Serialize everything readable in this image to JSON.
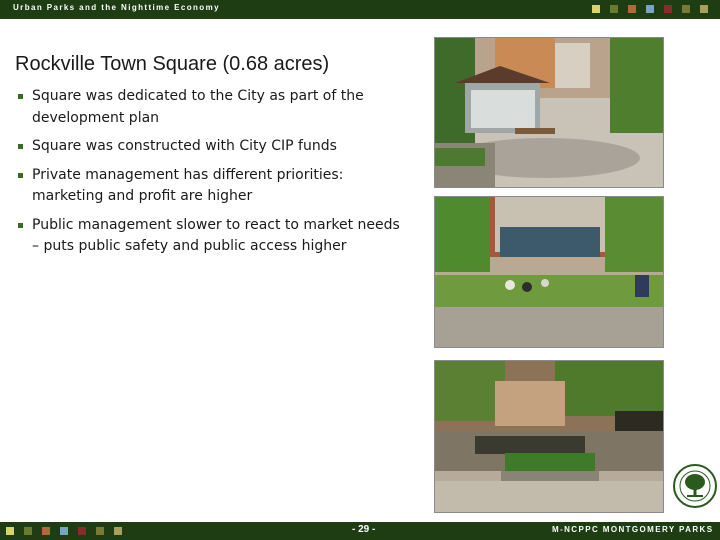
{
  "header": {
    "title": "Urban Parks and the Nighttime Economy"
  },
  "slide": {
    "title": "Rockville Town Square (0.68 acres)",
    "bullets": [
      "Square was dedicated to the City as part of the development plan",
      "Square was constructed with City CIP funds",
      "Private management has different priorities: marketing and profit are higher",
      "Public management slower to react to market needs – puts public safety and public access higher"
    ]
  },
  "decor": {
    "square_colors": [
      "#d8d36f",
      "#6b7a2c",
      "#b06a3a",
      "#7aa4c4",
      "#8a2a2a",
      "#7a7a35",
      "#a9a060"
    ]
  },
  "footer": {
    "page": "- 29 -",
    "org": "M-NCPPC MONTGOMERY PARKS"
  },
  "photos": [
    {
      "subject": "pavilion-plaza"
    },
    {
      "subject": "lawn-with-people"
    },
    {
      "subject": "plaza-with-planter"
    }
  ]
}
